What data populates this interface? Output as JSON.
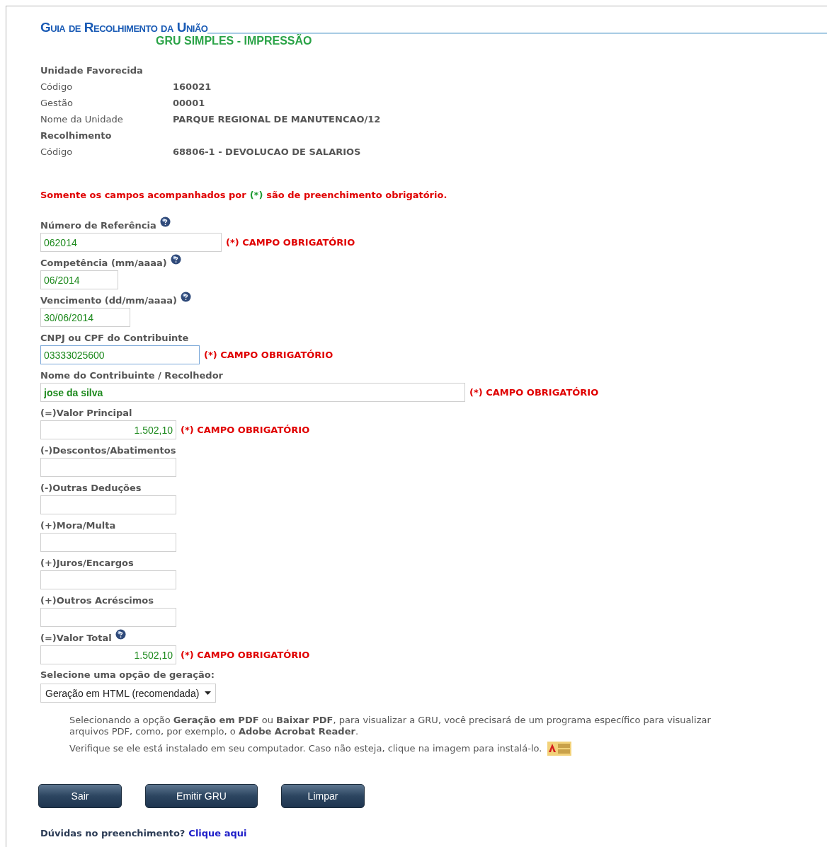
{
  "header": {
    "title": "Guia de Recolhimento da União",
    "subtitle": "GRU SIMPLES - IMPRESSÃO"
  },
  "info": [
    {
      "kind": "heading",
      "label": "Unidade Favorecida"
    },
    {
      "kind": "row",
      "label": "Código",
      "value": "160021"
    },
    {
      "kind": "row",
      "label": "Gestão",
      "value": "00001"
    },
    {
      "kind": "row",
      "label": "Nome da Unidade",
      "value": "PARQUE REGIONAL DE MANUTENCAO/12"
    },
    {
      "kind": "heading",
      "label": "Recolhimento"
    },
    {
      "kind": "row",
      "label": "Código",
      "value": "68806-1 - DEVOLUCAO DE SALARIOS"
    }
  ],
  "notice": {
    "before": "Somente os campos acompanhados por",
    "mark": "(*)",
    "after": "são de preenchimento obrigatório."
  },
  "fields": [
    {
      "kind": "reference",
      "label": "Número de Referência",
      "help": true,
      "value": "062014",
      "required": "(*) CAMPO OBRIGATÓRIO",
      "focused": false
    },
    {
      "kind": "period",
      "label": "Competência (mm/aaaa)",
      "help": true,
      "value": "06/2014",
      "focused": false
    },
    {
      "kind": "date",
      "label": "Vencimento (dd/mm/aaaa)",
      "help": true,
      "value": "30/06/2014",
      "focused": false
    },
    {
      "kind": "document",
      "label": "CNPJ ou CPF do Contribuinte",
      "help": false,
      "value": "03333025600",
      "required": "(*) CAMPO OBRIGATÓRIO",
      "focused": true
    },
    {
      "kind": "name",
      "label": "Nome do Contribuinte / Recolhedor",
      "help": false,
      "value": "jose da silva",
      "bold": true,
      "required": "(*) CAMPO OBRIGATÓRIO",
      "focused": false
    },
    {
      "kind": "amount",
      "label": "(=)Valor Principal",
      "help": false,
      "value": "1.502,10",
      "required": "(*) CAMPO OBRIGATÓRIO",
      "focused": false
    },
    {
      "kind": "amount",
      "label": "(-)Descontos/Abatimentos",
      "help": false,
      "focused": false
    },
    {
      "kind": "amount",
      "label": "(-)Outras Deduções",
      "help": false,
      "focused": false
    },
    {
      "kind": "amount",
      "label": "(+)Mora/Multa",
      "help": false,
      "focused": false
    },
    {
      "kind": "amount",
      "label": "(+)Juros/Encargos",
      "help": false,
      "focused": false
    },
    {
      "kind": "amount",
      "label": "(+)Outros Acréscimos",
      "help": false,
      "focused": false
    },
    {
      "kind": "amount",
      "label": "(=)Valor Total",
      "help": true,
      "value": "1.502,10",
      "required": "(*) CAMPO OBRIGATÓRIO",
      "focused": false
    }
  ],
  "generation": {
    "label": "Selecione uma opção de geração:",
    "value": "Geração em HTML (recomendada)"
  },
  "help_text": [
    "Selecionando a opção **Geração em PDF** ou **Baixar PDF**, para visualizar a GRU, você precisará de um programa específico para visualizar arquivos PDF, como, por exemplo, o **Adobe Acrobat Reader**.",
    "Verifique se ele está instalado em seu computador. Caso não esteja, clique na imagem para instalá-lo."
  ],
  "buttons": [
    "Sair",
    "Emitir GRU",
    "Limpar"
  ],
  "footer": {
    "question": "Dúvidas no preenchimento?",
    "link": "Clique aqui"
  }
}
